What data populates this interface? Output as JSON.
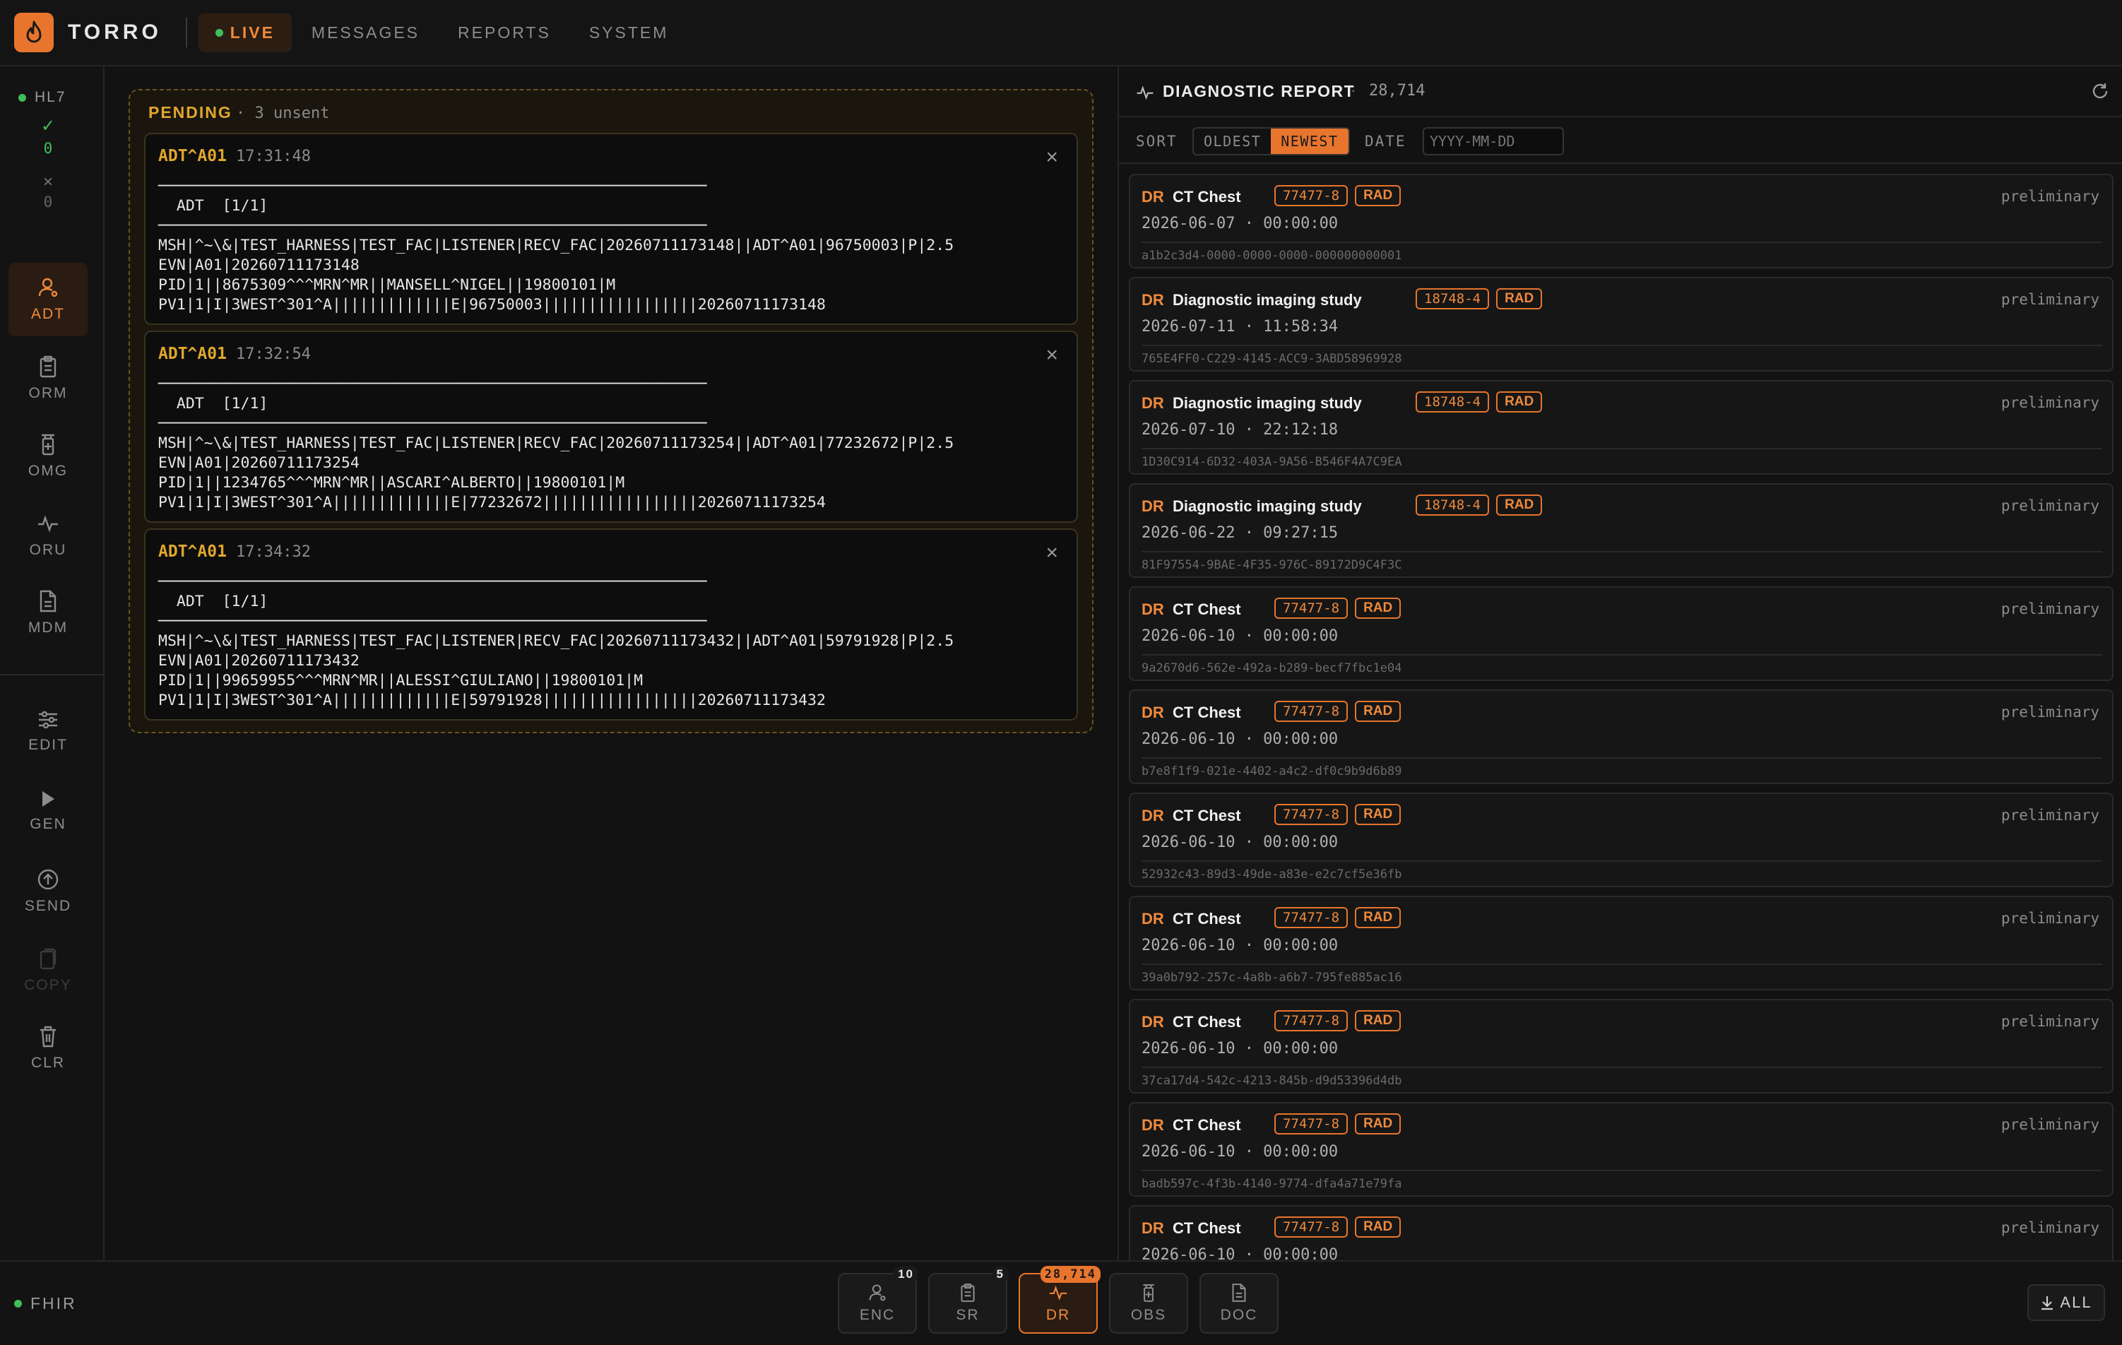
{
  "header": {
    "brand": "TORRO",
    "nav": [
      {
        "label": "LIVE"
      },
      {
        "label": "MESSAGES"
      },
      {
        "label": "REPORTS"
      },
      {
        "label": "SYSTEM"
      }
    ]
  },
  "rail": {
    "status_label": "HL7",
    "ok_mark": "✓",
    "ok_count": "0",
    "err_mark": "×",
    "err_count": "0",
    "items": [
      {
        "label": "ADT",
        "icon": "user-icon"
      },
      {
        "label": "ORM",
        "icon": "clipboard-icon"
      },
      {
        "label": "OMG",
        "icon": "vial-icon"
      },
      {
        "label": "ORU",
        "icon": "pulse-icon"
      },
      {
        "label": "MDM",
        "icon": "document-icon"
      },
      {
        "label": "EDIT",
        "icon": "sliders-icon"
      },
      {
        "label": "GEN",
        "icon": "play-icon"
      },
      {
        "label": "SEND",
        "icon": "upload-icon"
      },
      {
        "label": "COPY",
        "icon": "copy-icon"
      },
      {
        "label": "CLR",
        "icon": "trash-icon"
      }
    ],
    "footer_label": "FHIR"
  },
  "pending": {
    "title": "PENDING",
    "subtitle": "· 3 unsent",
    "messages": [
      {
        "type": "ADT^A01",
        "time": "17:31:48",
        "body": "────────────────────────────────────────────────────────────\n  ADT  [1/1]\n────────────────────────────────────────────────────────────\nMSH|^~\\&|TEST_HARNESS|TEST_FAC|LISTENER|RECV_FAC|20260711173148||ADT^A01|96750003|P|2.5\nEVN|A01|20260711173148\nPID|1||8675309^^^MRN^MR||MANSELL^NIGEL||19800101|M\nPV1|1|I|3WEST^301^A|||||||||||||E|96750003|||||||||||||||||20260711173148"
      },
      {
        "type": "ADT^A01",
        "time": "17:32:54",
        "body": "────────────────────────────────────────────────────────────\n  ADT  [1/1]\n────────────────────────────────────────────────────────────\nMSH|^~\\&|TEST_HARNESS|TEST_FAC|LISTENER|RECV_FAC|20260711173254||ADT^A01|77232672|P|2.5\nEVN|A01|20260711173254\nPID|1||1234765^^^MRN^MR||ASCARI^ALBERTO||19800101|M\nPV1|1|I|3WEST^301^A|||||||||||||E|77232672|||||||||||||||||20260711173254"
      },
      {
        "type": "ADT^A01",
        "time": "17:34:32",
        "body": "────────────────────────────────────────────────────────────\n  ADT  [1/1]\n────────────────────────────────────────────────────────────\nMSH|^~\\&|TEST_HARNESS|TEST_FAC|LISTENER|RECV_FAC|20260711173432||ADT^A01|59791928|P|2.5\nEVN|A01|20260711173432\nPID|1||99659955^^^MRN^MR||ALESSI^GIULIANO||19800101|M\nPV1|1|I|3WEST^301^A|||||||||||||E|59791928|||||||||||||||||20260711173432"
      }
    ]
  },
  "report": {
    "title": "DIAGNOSTIC REPORT",
    "sep": "·",
    "count": "28,714",
    "sort_label": "SORT",
    "sort_options": [
      "OLDEST",
      "NEWEST"
    ],
    "sort_selected": "NEWEST",
    "date_label": "DATE",
    "date_placeholder": "YYYY-MM-DD",
    "items": [
      {
        "tag": "DR",
        "name": "CT Chest",
        "code": "77477-8",
        "cat": "RAD",
        "status": "preliminary",
        "date": "2026-06-07 · 00:00:00",
        "id": "a1b2c3d4-0000-0000-0000-000000000001"
      },
      {
        "tag": "DR",
        "name": "Diagnostic imaging study",
        "code": "18748-4",
        "cat": "RAD",
        "status": "preliminary",
        "date": "2026-07-11 · 11:58:34",
        "id": "765E4FF0-C229-4145-ACC9-3ABD58969928"
      },
      {
        "tag": "DR",
        "name": "Diagnostic imaging study",
        "code": "18748-4",
        "cat": "RAD",
        "status": "preliminary",
        "date": "2026-07-10 · 22:12:18",
        "id": "1D30C914-6D32-403A-9A56-B546F4A7C9EA"
      },
      {
        "tag": "DR",
        "name": "Diagnostic imaging study",
        "code": "18748-4",
        "cat": "RAD",
        "status": "preliminary",
        "date": "2026-06-22 · 09:27:15",
        "id": "81F97554-9BAE-4F35-976C-89172D9C4F3C"
      },
      {
        "tag": "DR",
        "name": "CT Chest",
        "code": "77477-8",
        "cat": "RAD",
        "status": "preliminary",
        "date": "2026-06-10 · 00:00:00",
        "id": "9a2670d6-562e-492a-b289-becf7fbc1e04"
      },
      {
        "tag": "DR",
        "name": "CT Chest",
        "code": "77477-8",
        "cat": "RAD",
        "status": "preliminary",
        "date": "2026-06-10 · 00:00:00",
        "id": "b7e8f1f9-021e-4402-a4c2-df0c9b9d6b89"
      },
      {
        "tag": "DR",
        "name": "CT Chest",
        "code": "77477-8",
        "cat": "RAD",
        "status": "preliminary",
        "date": "2026-06-10 · 00:00:00",
        "id": "52932c43-89d3-49de-a83e-e2c7cf5e36fb"
      },
      {
        "tag": "DR",
        "name": "CT Chest",
        "code": "77477-8",
        "cat": "RAD",
        "status": "preliminary",
        "date": "2026-06-10 · 00:00:00",
        "id": "39a0b792-257c-4a8b-a6b7-795fe885ac16"
      },
      {
        "tag": "DR",
        "name": "CT Chest",
        "code": "77477-8",
        "cat": "RAD",
        "status": "preliminary",
        "date": "2026-06-10 · 00:00:00",
        "id": "37ca17d4-542c-4213-845b-d9d53396d4db"
      },
      {
        "tag": "DR",
        "name": "CT Chest",
        "code": "77477-8",
        "cat": "RAD",
        "status": "preliminary",
        "date": "2026-06-10 · 00:00:00",
        "id": "badb597c-4f3b-4140-9774-dfa4a71e79fa"
      },
      {
        "tag": "DR",
        "name": "CT Chest",
        "code": "77477-8",
        "cat": "RAD",
        "status": "preliminary",
        "date": "2026-06-10 · 00:00:00",
        "id": ""
      }
    ]
  },
  "bottom": {
    "tabs": [
      {
        "label": "ENC",
        "badge": "10",
        "icon": "user-icon"
      },
      {
        "label": "SR",
        "badge": "5",
        "icon": "clipboard-icon"
      },
      {
        "label": "DR",
        "badge": "28,714",
        "icon": "pulse-icon"
      },
      {
        "label": "OBS",
        "badge": "",
        "icon": "vial-icon"
      },
      {
        "label": "DOC",
        "badge": "",
        "icon": "document-icon"
      }
    ],
    "active_tab": "DR",
    "all_label": "ALL"
  },
  "colors": {
    "accent": "#e8752d",
    "pending": "#e0a62e",
    "ok": "#3fbf5a",
    "bg": "#121212"
  }
}
